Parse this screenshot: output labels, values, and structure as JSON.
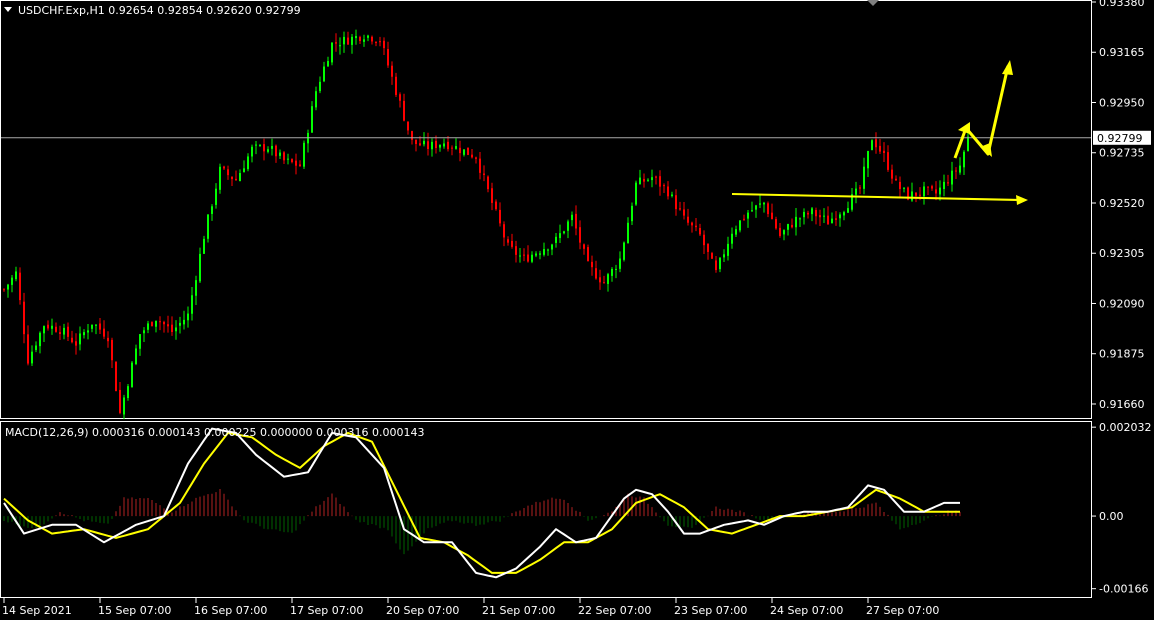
{
  "header": {
    "symbol_line": "USDCHF.Exp,H1  0.92654 0.92854 0.92620 0.92799",
    "macd_line": "MACD(12,26,9) 0.000316 0.000143 0.000225 0.000000 0.000316 0.000143"
  },
  "colors": {
    "background": "#000000",
    "bull": "#00ff00",
    "bear": "#ff0000",
    "grid_frame": "#ffffff",
    "current_price_line": "#a9a9a9",
    "annotation": "#ffff00",
    "macd_main": "#ffffff",
    "macd_signal": "#ffff00",
    "hist_pos": "#b22222",
    "hist_neg": "#006400"
  },
  "chart_data": [
    {
      "type": "candlestick",
      "symbol": "USDCHF.Exp",
      "timeframe": "H1",
      "current_price_label": "0.92799",
      "ylim": [
        0.916,
        0.9338
      ],
      "y_ticks": [
        "0.93380",
        "0.93165",
        "0.92950",
        "0.92735",
        "0.92520",
        "0.92305",
        "0.92090",
        "0.91875",
        "0.91660"
      ],
      "y_tick_values": [
        0.9338,
        0.93165,
        0.9295,
        0.92735,
        0.9252,
        0.92305,
        0.9209,
        0.91875,
        0.9166
      ],
      "x_ticks": [
        "14 Sep 2021",
        "15 Sep 07:00",
        "16 Sep 07:00",
        "17 Sep 07:00",
        "20 Sep 07:00",
        "21 Sep 07:00",
        "22 Sep 07:00",
        "23 Sep 07:00",
        "24 Sep 07:00",
        "27 Sep 07:00"
      ],
      "x_tick_index": [
        0,
        24,
        48,
        72,
        96,
        120,
        144,
        168,
        192,
        216
      ],
      "close_path": [
        [
          0,
          0.9215
        ],
        [
          3,
          0.9222
        ],
        [
          6,
          0.9185
        ],
        [
          10,
          0.92
        ],
        [
          14,
          0.9198
        ],
        [
          18,
          0.9192
        ],
        [
          22,
          0.9201
        ],
        [
          26,
          0.9195
        ],
        [
          29,
          0.9162
        ],
        [
          34,
          0.9196
        ],
        [
          38,
          0.9203
        ],
        [
          42,
          0.9197
        ],
        [
          46,
          0.9204
        ],
        [
          50,
          0.9238
        ],
        [
          54,
          0.9266
        ],
        [
          58,
          0.9262
        ],
        [
          62,
          0.9275
        ],
        [
          66,
          0.9276
        ],
        [
          70,
          0.927
        ],
        [
          74,
          0.9268
        ],
        [
          78,
          0.93
        ],
        [
          82,
          0.932
        ],
        [
          86,
          0.9322
        ],
        [
          90,
          0.9324
        ],
        [
          94,
          0.9322
        ],
        [
          98,
          0.93
        ],
        [
          102,
          0.9278
        ],
        [
          106,
          0.9276
        ],
        [
          110,
          0.9278
        ],
        [
          114,
          0.9275
        ],
        [
          118,
          0.9272
        ],
        [
          122,
          0.9252
        ],
        [
          126,
          0.9233
        ],
        [
          130,
          0.9228
        ],
        [
          134,
          0.9232
        ],
        [
          138,
          0.9236
        ],
        [
          142,
          0.9246
        ],
        [
          146,
          0.9225
        ],
        [
          150,
          0.9218
        ],
        [
          154,
          0.9228
        ],
        [
          158,
          0.926
        ],
        [
          162,
          0.9263
        ],
        [
          166,
          0.9257
        ],
        [
          170,
          0.9245
        ],
        [
          174,
          0.9238
        ],
        [
          178,
          0.9222
        ],
        [
          182,
          0.924
        ],
        [
          186,
          0.9248
        ],
        [
          190,
          0.9252
        ],
        [
          194,
          0.9238
        ],
        [
          198,
          0.9245
        ],
        [
          202,
          0.9248
        ],
        [
          206,
          0.9244
        ],
        [
          210,
          0.925
        ],
        [
          214,
          0.9258
        ],
        [
          217,
          0.928
        ],
        [
          220,
          0.9272
        ],
        [
          223,
          0.926
        ],
        [
          226,
          0.9255
        ],
        [
          230,
          0.9257
        ],
        [
          233,
          0.9256
        ],
        [
          236,
          0.9262
        ],
        [
          239,
          0.9268
        ],
        [
          241,
          0.928
        ]
      ],
      "annotations": [
        "horizontal support arrow at 0.92545",
        "zig-zag upward arrow projection"
      ]
    },
    {
      "type": "macd",
      "params": "MACD(12,26,9)",
      "ylim": [
        -0.00185,
        0.00215
      ],
      "y_ticks": [
        "0.002032",
        "0.00",
        "-0.00166"
      ],
      "y_tick_values": [
        0.002032,
        0.0,
        -0.00166
      ],
      "main_path": [
        [
          0,
          0.0003
        ],
        [
          5,
          -0.0004
        ],
        [
          12,
          -0.0002
        ],
        [
          18,
          -0.0002
        ],
        [
          25,
          -0.0006
        ],
        [
          33,
          -0.0002
        ],
        [
          40,
          0.0
        ],
        [
          46,
          0.0012
        ],
        [
          52,
          0.002
        ],
        [
          58,
          0.0019
        ],
        [
          63,
          0.0014
        ],
        [
          70,
          0.0009
        ],
        [
          76,
          0.001
        ],
        [
          82,
          0.0019
        ],
        [
          88,
          0.0018
        ],
        [
          95,
          0.0011
        ],
        [
          100,
          -0.0003
        ],
        [
          105,
          -0.0006
        ],
        [
          112,
          -0.0006
        ],
        [
          118,
          -0.0013
        ],
        [
          123,
          -0.0014
        ],
        [
          128,
          -0.0012
        ],
        [
          134,
          -0.0007
        ],
        [
          138,
          -0.0003
        ],
        [
          143,
          -0.0006
        ],
        [
          148,
          -0.0005
        ],
        [
          155,
          0.0004
        ],
        [
          158,
          0.0006
        ],
        [
          162,
          0.0005
        ],
        [
          166,
          0.0001
        ],
        [
          170,
          -0.0004
        ],
        [
          174,
          -0.0004
        ],
        [
          180,
          -0.0002
        ],
        [
          186,
          -0.0001
        ],
        [
          190,
          -0.0002
        ],
        [
          195,
          0.0
        ],
        [
          200,
          0.0001
        ],
        [
          206,
          0.0001
        ],
        [
          211,
          0.0002
        ],
        [
          216,
          0.0007
        ],
        [
          220,
          0.0006
        ],
        [
          225,
          0.0001
        ],
        [
          230,
          0.0001
        ],
        [
          235,
          0.0003
        ]
      ],
      "signal_path": [
        [
          0,
          0.0004
        ],
        [
          6,
          -0.0001
        ],
        [
          12,
          -0.0004
        ],
        [
          20,
          -0.0003
        ],
        [
          28,
          -0.0005
        ],
        [
          36,
          -0.0003
        ],
        [
          44,
          0.0003
        ],
        [
          50,
          0.0012
        ],
        [
          56,
          0.0019
        ],
        [
          62,
          0.0018
        ],
        [
          68,
          0.0014
        ],
        [
          74,
          0.0011
        ],
        [
          80,
          0.0016
        ],
        [
          86,
          0.0019
        ],
        [
          92,
          0.0017
        ],
        [
          98,
          0.0006
        ],
        [
          104,
          -0.0005
        ],
        [
          110,
          -0.0006
        ],
        [
          116,
          -0.0009
        ],
        [
          122,
          -0.0013
        ],
        [
          128,
          -0.0013
        ],
        [
          134,
          -0.001
        ],
        [
          140,
          -0.0006
        ],
        [
          146,
          -0.0006
        ],
        [
          152,
          -0.0003
        ],
        [
          158,
          0.0003
        ],
        [
          164,
          0.0005
        ],
        [
          170,
          0.0002
        ],
        [
          176,
          -0.0003
        ],
        [
          182,
          -0.0004
        ],
        [
          188,
          -0.0002
        ],
        [
          194,
          0.0
        ],
        [
          200,
          0.0
        ],
        [
          206,
          0.0001
        ],
        [
          212,
          0.0002
        ],
        [
          218,
          0.0006
        ],
        [
          224,
          0.0004
        ],
        [
          230,
          0.0001
        ],
        [
          235,
          0.0001
        ]
      ],
      "histogram_path": [
        [
          0,
          -0.0001
        ],
        [
          8,
          -0.0003
        ],
        [
          14,
          0.0001
        ],
        [
          20,
          -0.0001
        ],
        [
          26,
          -0.0002
        ],
        [
          30,
          0.0004
        ],
        [
          36,
          0.0004
        ],
        [
          42,
          0.0001
        ],
        [
          48,
          0.0004
        ],
        [
          54,
          0.0006
        ],
        [
          60,
          -0.0001
        ],
        [
          66,
          -0.0003
        ],
        [
          72,
          -0.0004
        ],
        [
          78,
          0.0002
        ],
        [
          82,
          0.0005
        ],
        [
          88,
          -0.0001
        ],
        [
          96,
          -0.0003
        ],
        [
          100,
          -0.0009
        ],
        [
          106,
          -0.0003
        ],
        [
          112,
          -0.0001
        ],
        [
          118,
          -0.0002
        ],
        [
          124,
          -0.0001
        ],
        [
          130,
          0.0002
        ],
        [
          136,
          0.0004
        ],
        [
          140,
          0.0004
        ],
        [
          146,
          -0.0001
        ],
        [
          152,
          0.0001
        ],
        [
          156,
          0.0005
        ],
        [
          160,
          0.0004
        ],
        [
          166,
          -0.0002
        ],
        [
          172,
          -0.0003
        ],
        [
          178,
          0.0002
        ],
        [
          184,
          0.0001
        ],
        [
          190,
          -0.0001
        ],
        [
          196,
          0.0
        ],
        [
          202,
          0.0001
        ],
        [
          208,
          0.0001
        ],
        [
          214,
          0.0002
        ],
        [
          218,
          0.0003
        ],
        [
          224,
          -0.0003
        ],
        [
          230,
          -0.0001
        ],
        [
          236,
          0.0001
        ]
      ]
    }
  ]
}
